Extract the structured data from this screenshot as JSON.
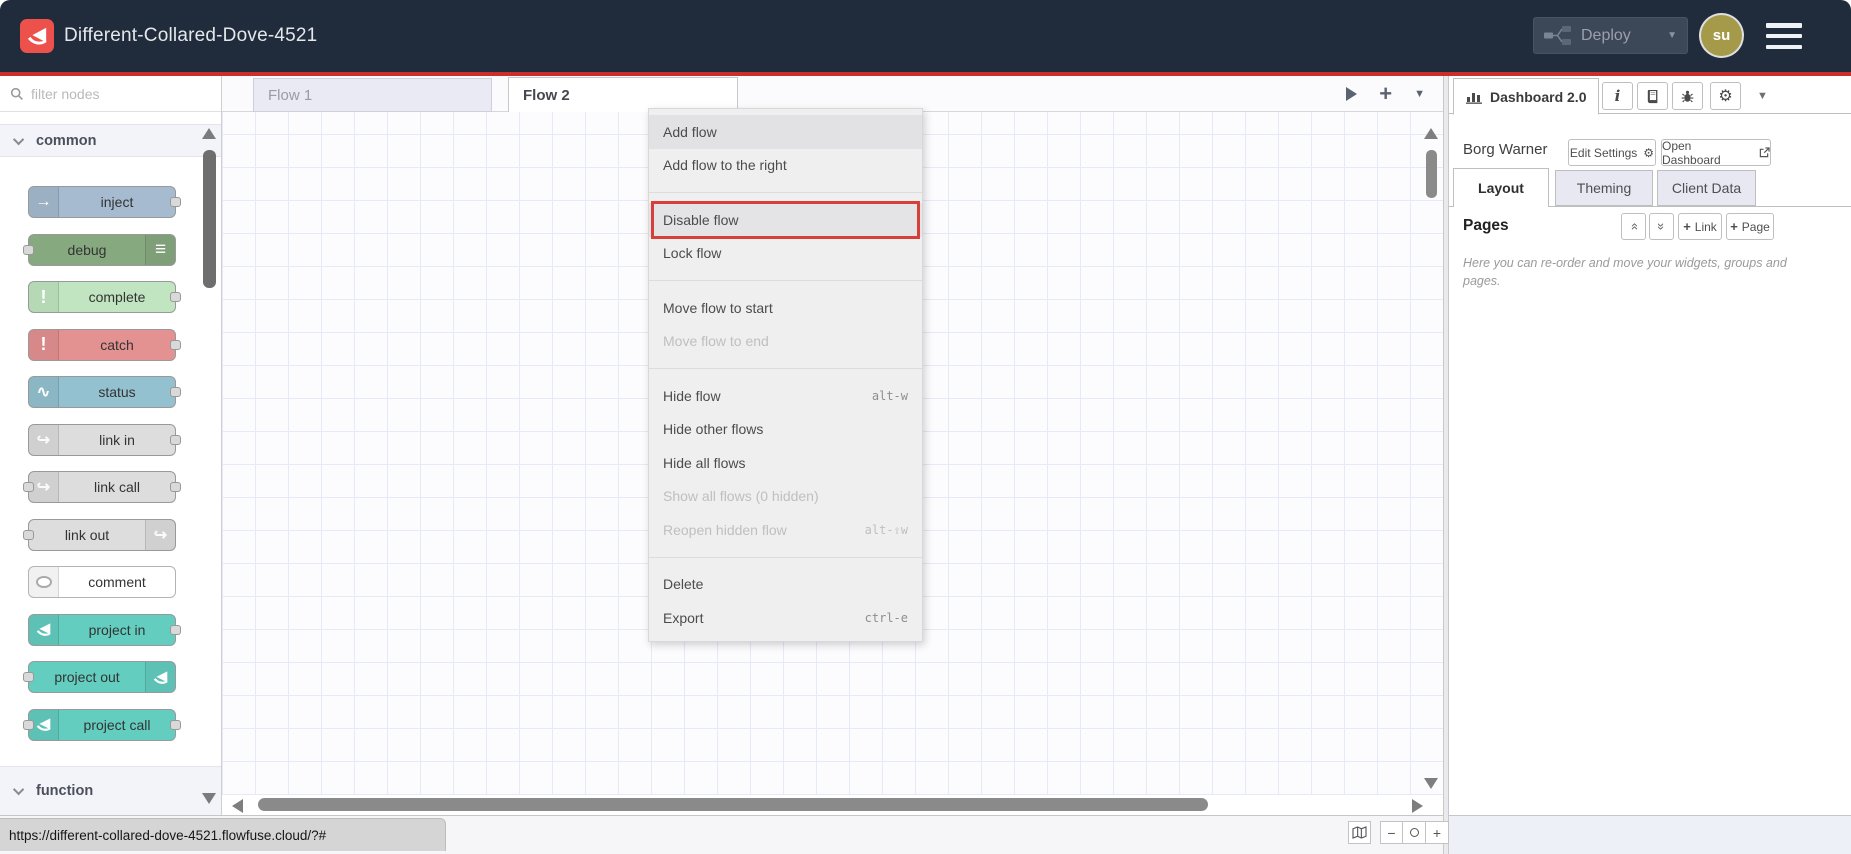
{
  "header": {
    "title": "Different-Collared-Dove-4521",
    "deploy_label": "Deploy",
    "avatar_initials": "su"
  },
  "colors": {
    "header_bg": "#202b3b",
    "accent_red": "#c9302b",
    "annotation_red": "#d6403a",
    "avatar_bg": "#a59a4a",
    "project_node_teal": "#63cdc0"
  },
  "palette": {
    "search_placeholder": "filter nodes",
    "categories": [
      {
        "label": "common"
      },
      {
        "label": "function"
      }
    ],
    "nodes": [
      {
        "label": "inject",
        "color": "#a6bbcf",
        "icon": "arrow",
        "icon_side": "left",
        "ports": "right"
      },
      {
        "label": "debug",
        "color": "#87a980",
        "icon": "bars",
        "icon_side": "right",
        "ports": "left"
      },
      {
        "label": "complete",
        "color": "#c0e5c0",
        "icon": "exclaim",
        "icon_side": "left",
        "ports": "right"
      },
      {
        "label": "catch",
        "color": "#e49191",
        "icon": "exclaim",
        "icon_side": "left",
        "ports": "right"
      },
      {
        "label": "status",
        "color": "#94c1d0",
        "icon": "pulse",
        "icon_side": "left",
        "ports": "right"
      },
      {
        "label": "link in",
        "color": "#dddddd",
        "icon": "link",
        "icon_side": "left",
        "ports": "right"
      },
      {
        "label": "link call",
        "color": "#dddddd",
        "icon": "link",
        "icon_side": "left",
        "ports": "both"
      },
      {
        "label": "link out",
        "color": "#dddddd",
        "icon": "link",
        "icon_side": "right",
        "ports": "left"
      },
      {
        "label": "comment",
        "color": "#ffffff",
        "icon": "bubble",
        "icon_side": "left",
        "ports": "none"
      },
      {
        "label": "project in",
        "color": "#63cdc0",
        "icon": "ff",
        "icon_side": "left",
        "ports": "right"
      },
      {
        "label": "project out",
        "color": "#63cdc0",
        "icon": "ff",
        "icon_side": "right",
        "ports": "left"
      },
      {
        "label": "project call",
        "color": "#63cdc0",
        "icon": "ff",
        "icon_side": "left",
        "ports": "both"
      }
    ]
  },
  "tabs": {
    "items": [
      {
        "label": "Flow 1",
        "active": false
      },
      {
        "label": "Flow 2",
        "active": true
      }
    ]
  },
  "context_menu": {
    "items": [
      {
        "label": "Add flow",
        "state": "hover"
      },
      {
        "label": "Add flow to the right"
      },
      {
        "sep": true
      },
      {
        "label": "Disable flow",
        "state": "annotated"
      },
      {
        "label": "Lock flow"
      },
      {
        "sep": true
      },
      {
        "label": "Move flow to start"
      },
      {
        "label": "Move flow to end",
        "disabled": true
      },
      {
        "sep": true
      },
      {
        "label": "Hide flow",
        "shortcut": "alt-w"
      },
      {
        "label": "Hide other flows"
      },
      {
        "label": "Hide all flows"
      },
      {
        "label": "Show all flows (0 hidden)",
        "disabled": true
      },
      {
        "label": "Reopen hidden flow",
        "disabled": true,
        "shortcut": "alt-⇧w"
      },
      {
        "sep": true
      },
      {
        "label": "Delete"
      },
      {
        "label": "Export",
        "shortcut": "ctrl-e"
      }
    ]
  },
  "sidebar": {
    "tab_label": "Dashboard 2.0",
    "toolbar_icon_names": [
      "info-icon",
      "book-icon",
      "bug-icon",
      "gear-icon",
      "chevron-down-icon"
    ],
    "instance_name": "Borg Warner",
    "edit_settings_label": "Edit Settings",
    "open_dashboard_label": "Open Dashboard",
    "tabs": [
      {
        "label": "Layout",
        "active": true
      },
      {
        "label": "Theming",
        "active": false
      },
      {
        "label": "Client Data",
        "active": false
      }
    ],
    "pages_title": "Pages",
    "link_button_label": "Link",
    "page_button_label": "Page",
    "help_text": "Here you can re-order and move your widgets, groups and pages."
  },
  "statusbar": {
    "url": "https://different-collared-dove-4521.flowfuse.cloud/?#"
  }
}
